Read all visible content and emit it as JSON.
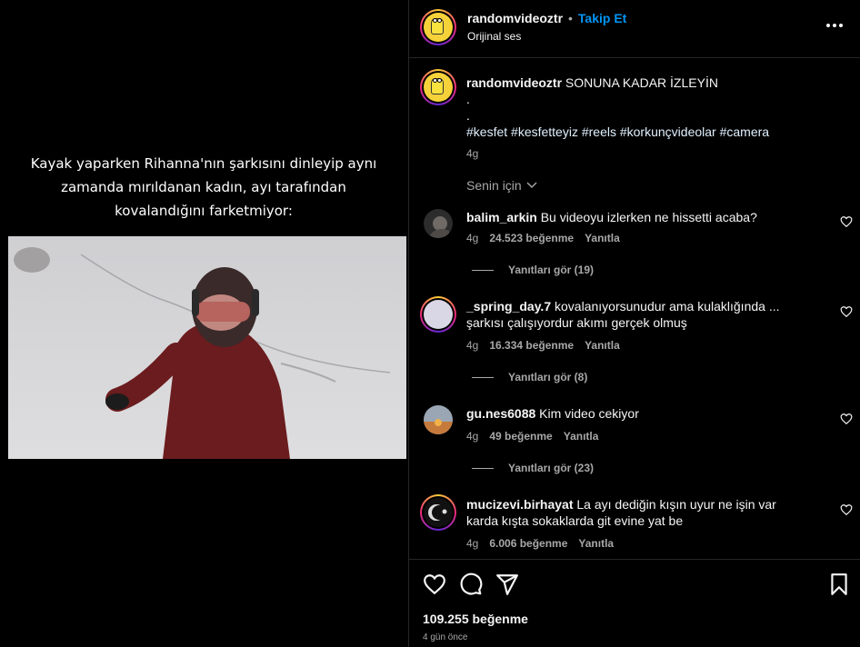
{
  "video": {
    "caption_lines": [
      "Kayak yaparken Rihanna'nın şarkısını dinleyip aynı",
      "zamanda mırıldanan kadın, ayı tarafından",
      "kovalandığını farketmiyor:"
    ]
  },
  "header": {
    "username": "randomvideoztr",
    "dot": "•",
    "follow": "Takip Et",
    "audio": "Orijinal ses",
    "more_icon": "more-horizontal-icon"
  },
  "post": {
    "username": "randomvideoztr",
    "text": "SONUNA KADAR İZLEYİN",
    "dot1": ".",
    "dot2": ".",
    "hashtags": "#kesfet #kesfetteyiz #reels #korkunçvideolar #camera",
    "time": "4g"
  },
  "sort": {
    "label": "Senin için",
    "icon": "chevron-down-icon"
  },
  "comments": [
    {
      "username": "balim_arkin",
      "text": "Bu videoyu izlerken ne hissetti acaba?",
      "time": "4g",
      "likes": "24.523 beğenme",
      "reply": "Yanıtla",
      "view_replies": "Yanıtları gör (19)"
    },
    {
      "username": "_spring_day.7",
      "text": "kovalanıyorsunudur ama kulaklığında ... şarkısı çalışıyordur akımı gerçek olmuş",
      "time": "4g",
      "likes": "16.334 beğenme",
      "reply": "Yanıtla",
      "view_replies": "Yanıtları gör (8)"
    },
    {
      "username": "gu.nes6088",
      "text": "Kim video cekiyor",
      "time": "4g",
      "likes": "49 beğenme",
      "reply": "Yanıtla",
      "view_replies": "Yanıtları gör (23)"
    },
    {
      "username": "mucizevi.birhayat",
      "text": "La ayı dediğin kışın uyur ne işin var karda kışta sokaklarda git evine yat be",
      "time": "4g",
      "likes": "6.006 beğenme",
      "reply": "Yanıtla"
    }
  ],
  "actions": {
    "like_icon": "heart-icon",
    "comment_icon": "comment-icon",
    "share_icon": "send-icon",
    "save_icon": "bookmark-icon",
    "likes": "109.255 beğenme",
    "posted": "4 gün önce"
  }
}
